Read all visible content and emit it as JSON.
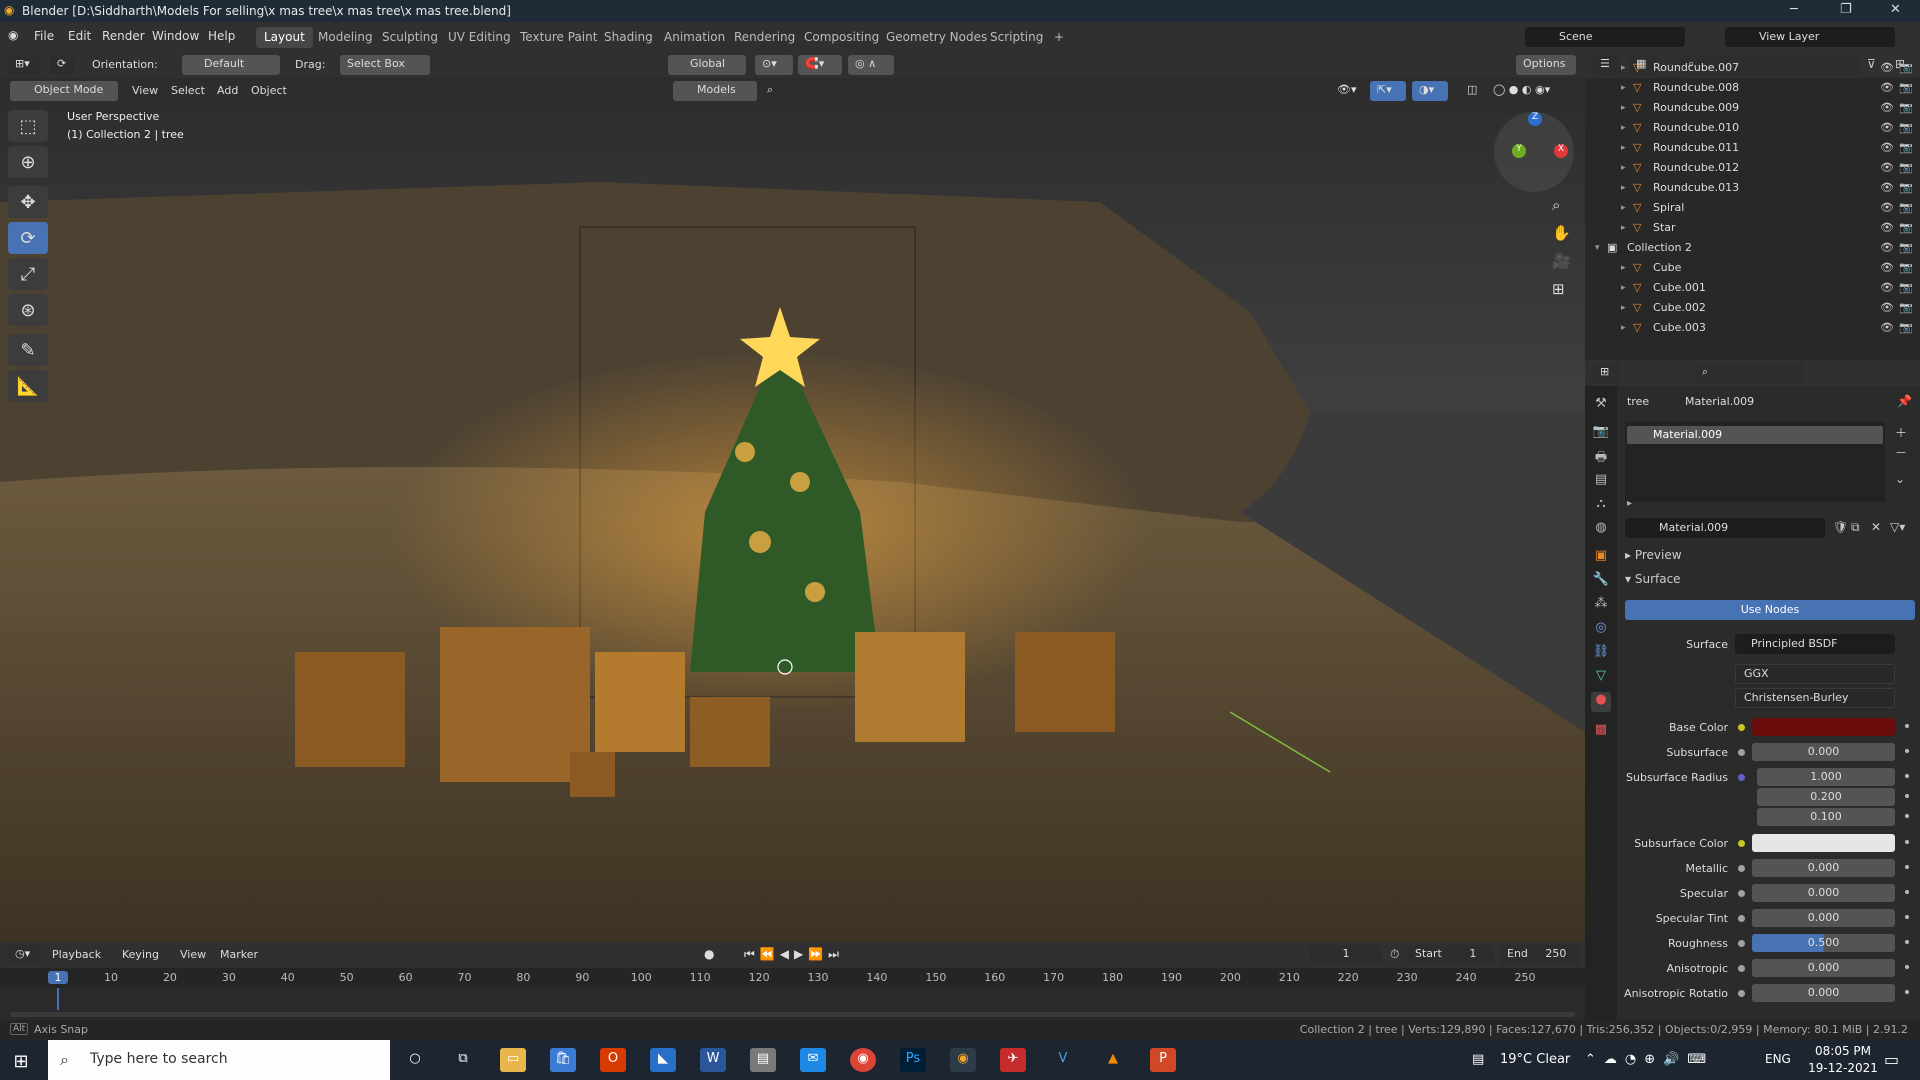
{
  "titlebar": {
    "title": "Blender [D:\\Siddharth\\Models For selling\\x mas tree\\x mas tree\\x mas tree.blend]",
    "min": "─",
    "max": "❐",
    "close": "✕"
  },
  "menu": [
    "File",
    "Edit",
    "Render",
    "Window",
    "Help"
  ],
  "workspaces": [
    "Layout",
    "Modeling",
    "Sculpting",
    "UV Editing",
    "Texture Paint",
    "Shading",
    "Animation",
    "Rendering",
    "Compositing",
    "Geometry Nodes",
    "Scripting"
  ],
  "scene": {
    "label": "Scene",
    "view_layer": "View Layer"
  },
  "tool_header": {
    "orientation_label": "Orientation:",
    "orientation": "Default",
    "drag_label": "Drag:",
    "drag": "Select Box",
    "transform": "Global",
    "options": "Options"
  },
  "viewport_header": {
    "mode": "Object Mode",
    "view": "View",
    "select": "Select",
    "add": "Add",
    "object": "Object",
    "models": "Models"
  },
  "viewport": {
    "perspective": "User Perspective",
    "context": "(1) Collection 2 | tree",
    "gizmo": {
      "x": "X",
      "y": "Y",
      "z": "Z"
    }
  },
  "outliner": {
    "rows": [
      {
        "name": "Roundcube.007",
        "indent": 1
      },
      {
        "name": "Roundcube.008",
        "indent": 1
      },
      {
        "name": "Roundcube.009",
        "indent": 1
      },
      {
        "name": "Roundcube.010",
        "indent": 1
      },
      {
        "name": "Roundcube.011",
        "indent": 1
      },
      {
        "name": "Roundcube.012",
        "indent": 1
      },
      {
        "name": "Roundcube.013",
        "indent": 1
      },
      {
        "name": "Spiral",
        "indent": 1
      },
      {
        "name": "Star",
        "indent": 1
      },
      {
        "name": "Collection 2",
        "indent": 0
      },
      {
        "name": "Cube",
        "indent": 1
      },
      {
        "name": "Cube.001",
        "indent": 1
      },
      {
        "name": "Cube.002",
        "indent": 1
      },
      {
        "name": "Cube.003",
        "indent": 1
      }
    ]
  },
  "props": {
    "breadcrumb_obj": "tree",
    "breadcrumb_mat": "Material.009",
    "slot": "Material.009",
    "material_name": "Material.009",
    "preview": "Preview",
    "surface_panel": "Surface",
    "use_nodes": "Use Nodes",
    "surface_label": "Surface",
    "surface_value": "Principled BSDF",
    "dist": "GGX",
    "sss_method": "Christensen-Burley",
    "fields": [
      {
        "label": "Base Color",
        "value": "",
        "color": "#6b0c0c"
      },
      {
        "label": "Subsurface",
        "value": "0.000"
      },
      {
        "label": "Subsurface Radius",
        "value": "1.000"
      },
      {
        "label": "",
        "value": "0.200"
      },
      {
        "label": "",
        "value": "0.100"
      },
      {
        "label": "Subsurface Color",
        "value": "",
        "color": "#e6e6e6"
      },
      {
        "label": "Metallic",
        "value": "0.000"
      },
      {
        "label": "Specular",
        "value": "0.000"
      },
      {
        "label": "Specular Tint",
        "value": "0.000"
      },
      {
        "label": "Roughness",
        "value": "0.500",
        "fill": 0.5
      },
      {
        "label": "Anisotropic",
        "value": "0.000"
      },
      {
        "label": "Anisotropic Rotatio",
        "value": "0.000"
      }
    ]
  },
  "timeline": {
    "playback": "Playback",
    "keying": "Keying",
    "view": "View",
    "marker": "Marker",
    "frame": "1",
    "start_label": "Start",
    "start": "1",
    "end_label": "End",
    "end": "250",
    "ticks": [
      "1",
      "10",
      "20",
      "30",
      "40",
      "50",
      "60",
      "70",
      "80",
      "90",
      "100",
      "110",
      "120",
      "130",
      "140",
      "150",
      "160",
      "170",
      "180",
      "190",
      "200",
      "210",
      "220",
      "230",
      "240",
      "250"
    ]
  },
  "status": {
    "left": "Axis Snap",
    "right": "Collection 2 | tree | Verts:129,890 | Faces:127,670 | Tris:256,352 | Objects:0/2,959 | Memory: 80.1 MiB | 2.91.2"
  },
  "taskbar": {
    "search": "Type here to search",
    "weather": "19°C  Clear",
    "lang": "ENG",
    "time": "08:05 PM",
    "date": "19-12-2021"
  }
}
